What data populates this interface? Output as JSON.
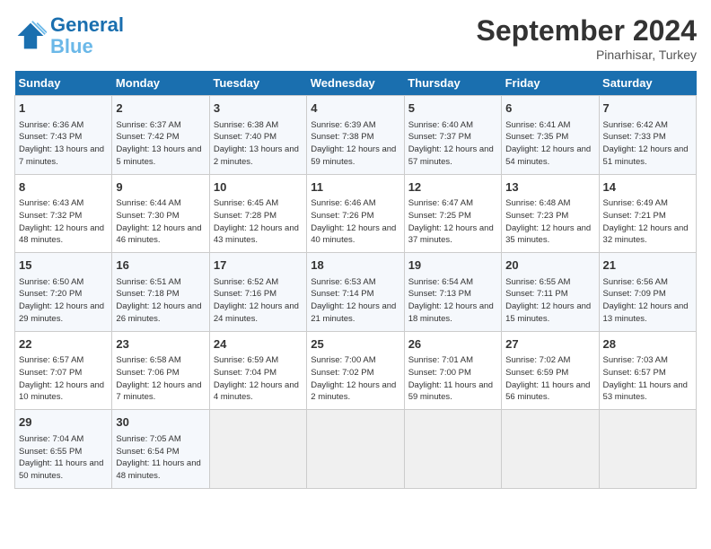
{
  "header": {
    "logo_line1": "General",
    "logo_line2": "Blue",
    "month": "September 2024",
    "location": "Pinarhisar, Turkey"
  },
  "days_of_week": [
    "Sunday",
    "Monday",
    "Tuesday",
    "Wednesday",
    "Thursday",
    "Friday",
    "Saturday"
  ],
  "weeks": [
    [
      {
        "day": "1",
        "sunrise": "Sunrise: 6:36 AM",
        "sunset": "Sunset: 7:43 PM",
        "daylight": "Daylight: 13 hours and 7 minutes."
      },
      {
        "day": "2",
        "sunrise": "Sunrise: 6:37 AM",
        "sunset": "Sunset: 7:42 PM",
        "daylight": "Daylight: 13 hours and 5 minutes."
      },
      {
        "day": "3",
        "sunrise": "Sunrise: 6:38 AM",
        "sunset": "Sunset: 7:40 PM",
        "daylight": "Daylight: 13 hours and 2 minutes."
      },
      {
        "day": "4",
        "sunrise": "Sunrise: 6:39 AM",
        "sunset": "Sunset: 7:38 PM",
        "daylight": "Daylight: 12 hours and 59 minutes."
      },
      {
        "day": "5",
        "sunrise": "Sunrise: 6:40 AM",
        "sunset": "Sunset: 7:37 PM",
        "daylight": "Daylight: 12 hours and 57 minutes."
      },
      {
        "day": "6",
        "sunrise": "Sunrise: 6:41 AM",
        "sunset": "Sunset: 7:35 PM",
        "daylight": "Daylight: 12 hours and 54 minutes."
      },
      {
        "day": "7",
        "sunrise": "Sunrise: 6:42 AM",
        "sunset": "Sunset: 7:33 PM",
        "daylight": "Daylight: 12 hours and 51 minutes."
      }
    ],
    [
      {
        "day": "8",
        "sunrise": "Sunrise: 6:43 AM",
        "sunset": "Sunset: 7:32 PM",
        "daylight": "Daylight: 12 hours and 48 minutes."
      },
      {
        "day": "9",
        "sunrise": "Sunrise: 6:44 AM",
        "sunset": "Sunset: 7:30 PM",
        "daylight": "Daylight: 12 hours and 46 minutes."
      },
      {
        "day": "10",
        "sunrise": "Sunrise: 6:45 AM",
        "sunset": "Sunset: 7:28 PM",
        "daylight": "Daylight: 12 hours and 43 minutes."
      },
      {
        "day": "11",
        "sunrise": "Sunrise: 6:46 AM",
        "sunset": "Sunset: 7:26 PM",
        "daylight": "Daylight: 12 hours and 40 minutes."
      },
      {
        "day": "12",
        "sunrise": "Sunrise: 6:47 AM",
        "sunset": "Sunset: 7:25 PM",
        "daylight": "Daylight: 12 hours and 37 minutes."
      },
      {
        "day": "13",
        "sunrise": "Sunrise: 6:48 AM",
        "sunset": "Sunset: 7:23 PM",
        "daylight": "Daylight: 12 hours and 35 minutes."
      },
      {
        "day": "14",
        "sunrise": "Sunrise: 6:49 AM",
        "sunset": "Sunset: 7:21 PM",
        "daylight": "Daylight: 12 hours and 32 minutes."
      }
    ],
    [
      {
        "day": "15",
        "sunrise": "Sunrise: 6:50 AM",
        "sunset": "Sunset: 7:20 PM",
        "daylight": "Daylight: 12 hours and 29 minutes."
      },
      {
        "day": "16",
        "sunrise": "Sunrise: 6:51 AM",
        "sunset": "Sunset: 7:18 PM",
        "daylight": "Daylight: 12 hours and 26 minutes."
      },
      {
        "day": "17",
        "sunrise": "Sunrise: 6:52 AM",
        "sunset": "Sunset: 7:16 PM",
        "daylight": "Daylight: 12 hours and 24 minutes."
      },
      {
        "day": "18",
        "sunrise": "Sunrise: 6:53 AM",
        "sunset": "Sunset: 7:14 PM",
        "daylight": "Daylight: 12 hours and 21 minutes."
      },
      {
        "day": "19",
        "sunrise": "Sunrise: 6:54 AM",
        "sunset": "Sunset: 7:13 PM",
        "daylight": "Daylight: 12 hours and 18 minutes."
      },
      {
        "day": "20",
        "sunrise": "Sunrise: 6:55 AM",
        "sunset": "Sunset: 7:11 PM",
        "daylight": "Daylight: 12 hours and 15 minutes."
      },
      {
        "day": "21",
        "sunrise": "Sunrise: 6:56 AM",
        "sunset": "Sunset: 7:09 PM",
        "daylight": "Daylight: 12 hours and 13 minutes."
      }
    ],
    [
      {
        "day": "22",
        "sunrise": "Sunrise: 6:57 AM",
        "sunset": "Sunset: 7:07 PM",
        "daylight": "Daylight: 12 hours and 10 minutes."
      },
      {
        "day": "23",
        "sunrise": "Sunrise: 6:58 AM",
        "sunset": "Sunset: 7:06 PM",
        "daylight": "Daylight: 12 hours and 7 minutes."
      },
      {
        "day": "24",
        "sunrise": "Sunrise: 6:59 AM",
        "sunset": "Sunset: 7:04 PM",
        "daylight": "Daylight: 12 hours and 4 minutes."
      },
      {
        "day": "25",
        "sunrise": "Sunrise: 7:00 AM",
        "sunset": "Sunset: 7:02 PM",
        "daylight": "Daylight: 12 hours and 2 minutes."
      },
      {
        "day": "26",
        "sunrise": "Sunrise: 7:01 AM",
        "sunset": "Sunset: 7:00 PM",
        "daylight": "Daylight: 11 hours and 59 minutes."
      },
      {
        "day": "27",
        "sunrise": "Sunrise: 7:02 AM",
        "sunset": "Sunset: 6:59 PM",
        "daylight": "Daylight: 11 hours and 56 minutes."
      },
      {
        "day": "28",
        "sunrise": "Sunrise: 7:03 AM",
        "sunset": "Sunset: 6:57 PM",
        "daylight": "Daylight: 11 hours and 53 minutes."
      }
    ],
    [
      {
        "day": "29",
        "sunrise": "Sunrise: 7:04 AM",
        "sunset": "Sunset: 6:55 PM",
        "daylight": "Daylight: 11 hours and 50 minutes."
      },
      {
        "day": "30",
        "sunrise": "Sunrise: 7:05 AM",
        "sunset": "Sunset: 6:54 PM",
        "daylight": "Daylight: 11 hours and 48 minutes."
      },
      null,
      null,
      null,
      null,
      null
    ]
  ]
}
